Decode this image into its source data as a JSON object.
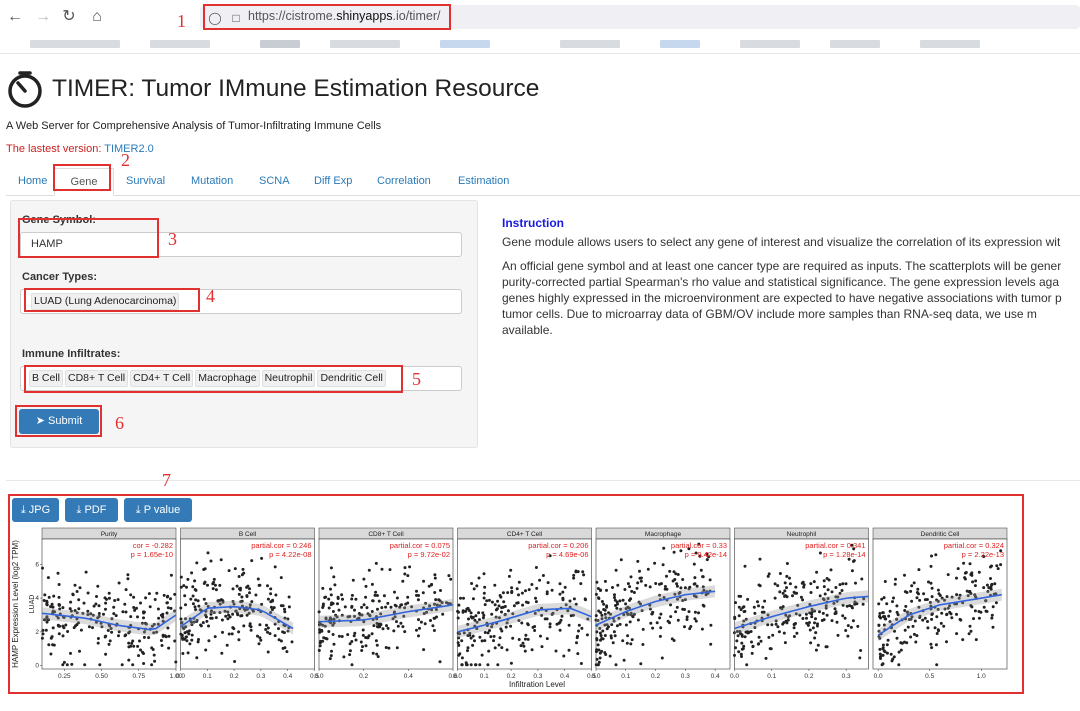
{
  "browser": {
    "url_prefix": "https://cistrome.",
    "url_host": "shinyapps",
    "url_suffix": ".io/timer/"
  },
  "annotations": [
    "1",
    "2",
    "3",
    "4",
    "5",
    "6",
    "7"
  ],
  "header": {
    "title": "TIMER: Tumor IMmune Estimation Resource",
    "subtitle": "A Web Server for Comprehensive Analysis of Tumor-Infiltrating Immune Cells",
    "latest_prefix": "The lastest version: ",
    "latest_link": "TIMER2.0"
  },
  "tabs": [
    {
      "label": "Home"
    },
    {
      "label": "Gene"
    },
    {
      "label": "Survival"
    },
    {
      "label": "Mutation"
    },
    {
      "label": "SCNA"
    },
    {
      "label": "Diff Exp"
    },
    {
      "label": "Correlation"
    },
    {
      "label": "Estimation"
    }
  ],
  "form": {
    "gene_label": "Gene Symbol:",
    "gene_value": "HAMP",
    "cancer_label": "Cancer Types:",
    "cancer_value": "LUAD (Lung Adenocarcinoma)",
    "immune_label": "Immune Infiltrates:",
    "immune_chips": [
      "B Cell",
      "CD8+ T Cell",
      "CD4+ T Cell",
      "Macrophage",
      "Neutrophil",
      "Dendritic Cell"
    ],
    "submit_label": "Submit"
  },
  "instruction": {
    "title": "Instruction",
    "p1": "Gene module allows users to select any gene of interest and visualize the correlation of its expression wit",
    "p2_lines": [
      "An official gene symbol and at least one cancer type are required as inputs. The scatterplots will be gener",
      "purity-corrected partial Spearman's rho value and statistical significance. The gene expression levels aga",
      "genes highly expressed in the microenvironment are expected to have negative associations with tumor p",
      "tumor cells. Due to microarray data of GBM/OV include more samples than RNA-seq data, we use m",
      "available."
    ]
  },
  "downloads": {
    "jpg": "JPG",
    "pdf": "PDF",
    "pvalue": "P value"
  },
  "chart_data": {
    "type": "scatter",
    "ylabel": "HAMP Expression Level (log2 TPM)",
    "row_label": "LUAD",
    "xlabel": "Infiltration Level",
    "y_ticks": [
      "0",
      "2",
      "4",
      "6"
    ],
    "panels": [
      {
        "name": "Purity",
        "stat_label": "cor = -0.282",
        "p_label": "p = 1.65e-10",
        "x_ticks": [
          "0.25",
          "0.50",
          "0.75",
          "1.00"
        ],
        "xlim": [
          0.1,
          1.0
        ],
        "trend": [
          [
            0.1,
            3.1
          ],
          [
            0.4,
            2.8
          ],
          [
            0.6,
            2.4
          ],
          [
            0.85,
            2.1
          ],
          [
            1.0,
            3.0
          ]
        ]
      },
      {
        "name": "B Cell",
        "stat_label": "partial.cor = 0.246",
        "p_label": "p = 4.22e-08",
        "x_ticks": [
          "0.0",
          "0.1",
          "0.2",
          "0.3",
          "0.4",
          "0.5"
        ],
        "xlim": [
          0.0,
          0.5
        ],
        "trend": [
          [
            0.0,
            2.3
          ],
          [
            0.1,
            3.4
          ],
          [
            0.2,
            3.5
          ],
          [
            0.3,
            3.3
          ],
          [
            0.42,
            2.2
          ]
        ]
      },
      {
        "name": "CD8+ T Cell",
        "stat_label": "partial.cor = 0.075",
        "p_label": "p = 9.72e-02",
        "x_ticks": [
          "0.0",
          "0.2",
          "0.4",
          "0.6"
        ],
        "xlim": [
          0.0,
          0.6
        ],
        "trend": [
          [
            0.0,
            2.6
          ],
          [
            0.2,
            2.7
          ],
          [
            0.4,
            3.2
          ],
          [
            0.6,
            3.6
          ]
        ]
      },
      {
        "name": "CD4+ T Cell",
        "stat_label": "partial.cor = 0.206",
        "p_label": "p = 4.69e-06",
        "x_ticks": [
          "0.0",
          "0.1",
          "0.2",
          "0.3",
          "0.4",
          "0.5"
        ],
        "xlim": [
          0.0,
          0.5
        ],
        "trend": [
          [
            0.0,
            2.0
          ],
          [
            0.15,
            2.6
          ],
          [
            0.3,
            3.3
          ],
          [
            0.42,
            3.4
          ],
          [
            0.5,
            2.9
          ]
        ]
      },
      {
        "name": "Macrophage",
        "stat_label": "partial.cor = 0.33",
        "p_label": "p = 9.42e-14",
        "x_ticks": [
          "0.0",
          "0.1",
          "0.2",
          "0.3",
          "0.4"
        ],
        "xlim": [
          0.0,
          0.45
        ],
        "trend": [
          [
            0.0,
            2.4
          ],
          [
            0.1,
            3.2
          ],
          [
            0.2,
            3.8
          ],
          [
            0.3,
            4.2
          ],
          [
            0.4,
            4.4
          ]
        ]
      },
      {
        "name": "Neutrophil",
        "stat_label": "partial.cor = 0.341",
        "p_label": "p = 1.28e-14",
        "x_ticks": [
          "0.0",
          "0.1",
          "0.2",
          "0.3"
        ],
        "xlim": [
          0.0,
          0.36
        ],
        "trend": [
          [
            0.0,
            2.2
          ],
          [
            0.1,
            2.9
          ],
          [
            0.2,
            3.5
          ],
          [
            0.3,
            4.0
          ],
          [
            0.36,
            4.1
          ]
        ]
      },
      {
        "name": "Dendritic Cell",
        "stat_label": "partial.cor = 0.324",
        "p_label": "p = 2.22e-13",
        "x_ticks": [
          "0.0",
          "0.5",
          "1.0"
        ],
        "xlim": [
          -0.05,
          1.25
        ],
        "trend": [
          [
            0.0,
            1.8
          ],
          [
            0.3,
            3.0
          ],
          [
            0.6,
            3.6
          ],
          [
            1.0,
            4.0
          ],
          [
            1.2,
            4.2
          ]
        ]
      }
    ],
    "ylim": [
      -0.2,
      7.5
    ]
  }
}
